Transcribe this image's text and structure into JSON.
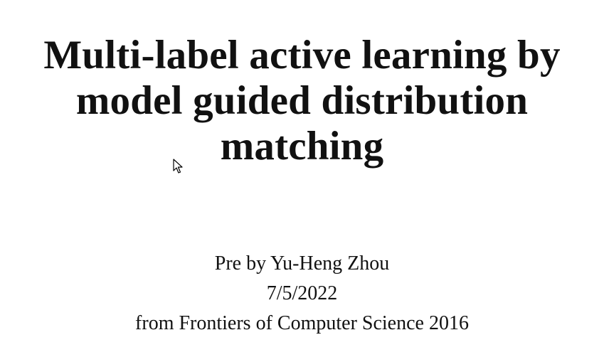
{
  "slide": {
    "title_lines": [
      "Multi-label active learning by",
      "model guided distribution",
      "matching"
    ],
    "author_line": "Pre by Yu-Heng Zhou",
    "date_line": "7/5/2022",
    "source_line": "from Frontiers of Computer Science 2016"
  },
  "icons": {
    "cursor": "mouse-pointer-icon"
  }
}
